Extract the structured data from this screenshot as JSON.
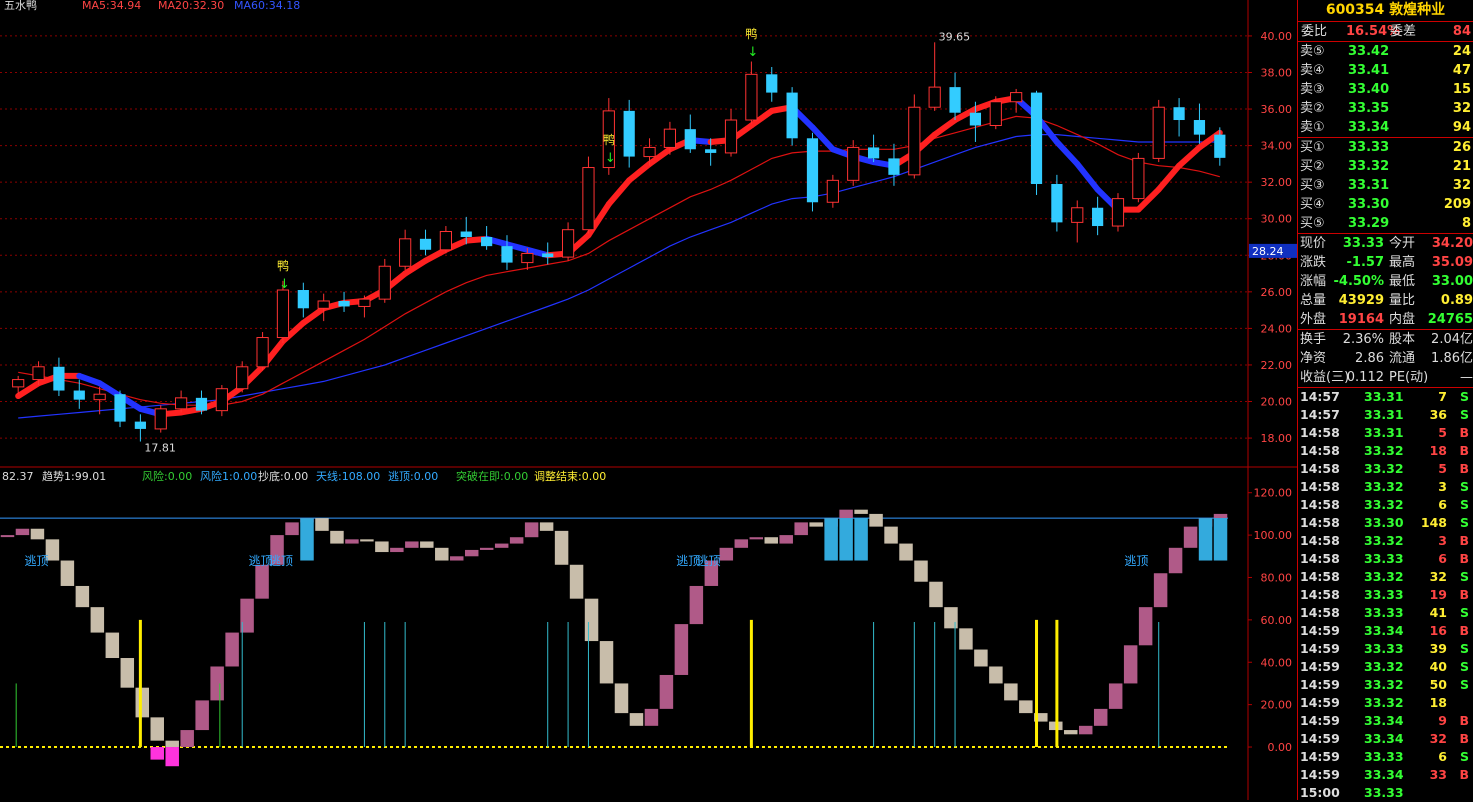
{
  "header": {
    "top_left_name": "五水鸭",
    "ma5_label": "MA5:34.94",
    "ma20_label": "MA20:32.30",
    "ma60_label": "MA60:34.18",
    "indicator_line": [
      {
        "text": "82.37",
        "color": "#dddddd"
      },
      {
        "text": "趋势1:99.01",
        "color": "#dddddd"
      },
      {
        "text": "风险:0.00",
        "color": "#33cc33"
      },
      {
        "text": "风险1:0.00",
        "color": "#33aaff"
      },
      {
        "text": "抄底:0.00",
        "color": "#dddddd"
      },
      {
        "text": "天线:108.00",
        "color": "#33aaff"
      },
      {
        "text": "逃顶:0.00",
        "color": "#33aaff"
      },
      {
        "text": "突破在即:0.00",
        "color": "#33cc33"
      },
      {
        "text": "调整结束:0.00",
        "color": "#ffee33"
      }
    ]
  },
  "colors": {
    "up": "#ff3333",
    "down": "#33ccff",
    "ma_red": "#ff2020",
    "ma_blue": "#2233ff",
    "grid": "#8b0000",
    "axis_text": "#ff4444",
    "pink": "#b05a88",
    "gray": "#c8bdaa",
    "cyan_bar": "#33aadd",
    "yellow": "#ffee00",
    "magenta": "#ff33dd",
    "cyan_low": "#33ffff"
  },
  "chart_data": [
    {
      "type": "candlestick",
      "y_ticks": [
        "18.00",
        "20.00",
        "22.00",
        "24.00",
        "26.00",
        "28.00",
        "30.00",
        "32.00",
        "34.00",
        "36.00",
        "38.00",
        "40.00"
      ],
      "ylim": [
        16.8,
        41.2
      ],
      "current_price_label": "28.24",
      "annotations": [
        {
          "text": "17.81",
          "x_index": 6,
          "value": 17.81
        },
        {
          "text": "39.65",
          "x_index": 45,
          "value": 39.65
        },
        {
          "text": "鸭",
          "x_index": 13,
          "value": 27.2
        },
        {
          "text": "鸭",
          "x_index": 29,
          "value": 34.1
        },
        {
          "text": "鸭",
          "x_index": 36,
          "value": 39.9
        }
      ],
      "candles": [
        [
          20.8,
          21.4,
          20.4,
          21.2
        ],
        [
          21.2,
          22.2,
          20.9,
          21.9
        ],
        [
          21.9,
          22.4,
          20.3,
          20.6
        ],
        [
          20.6,
          21.2,
          19.6,
          20.1
        ],
        [
          20.1,
          20.8,
          19.3,
          20.4
        ],
        [
          20.4,
          20.6,
          18.6,
          18.9
        ],
        [
          18.9,
          19.3,
          17.81,
          18.5
        ],
        [
          18.5,
          19.8,
          18.3,
          19.6
        ],
        [
          19.6,
          20.6,
          19.4,
          20.2
        ],
        [
          20.2,
          20.6,
          19.3,
          19.5
        ],
        [
          19.5,
          20.9,
          19.2,
          20.7
        ],
        [
          20.7,
          22.2,
          20.5,
          21.9
        ],
        [
          21.9,
          23.8,
          21.7,
          23.5
        ],
        [
          23.5,
          26.6,
          23.2,
          26.1
        ],
        [
          26.1,
          26.5,
          24.6,
          25.1
        ],
        [
          25.1,
          25.9,
          24.4,
          25.5
        ],
        [
          25.5,
          26.0,
          24.9,
          25.2
        ],
        [
          25.2,
          25.8,
          24.6,
          25.6
        ],
        [
          25.6,
          27.8,
          25.4,
          27.4
        ],
        [
          27.4,
          29.4,
          27.2,
          28.9
        ],
        [
          28.9,
          29.4,
          28.0,
          28.3
        ],
        [
          28.3,
          29.6,
          28.1,
          29.3
        ],
        [
          29.3,
          30.1,
          28.6,
          29.0
        ],
        [
          29.0,
          29.6,
          28.3,
          28.5
        ],
        [
          28.5,
          29.1,
          27.2,
          27.6
        ],
        [
          27.6,
          28.4,
          27.2,
          28.1
        ],
        [
          28.1,
          28.7,
          27.5,
          27.9
        ],
        [
          27.9,
          29.8,
          27.7,
          29.4
        ],
        [
          29.4,
          33.4,
          29.2,
          32.8
        ],
        [
          32.8,
          36.6,
          32.4,
          35.9
        ],
        [
          35.9,
          36.5,
          32.8,
          33.4
        ],
        [
          33.4,
          34.4,
          32.9,
          33.9
        ],
        [
          33.9,
          35.3,
          33.5,
          34.9
        ],
        [
          34.9,
          35.7,
          33.6,
          33.8
        ],
        [
          33.8,
          34.4,
          32.9,
          33.6
        ],
        [
          33.6,
          36.0,
          33.4,
          35.4
        ],
        [
          35.4,
          38.6,
          35.2,
          37.9
        ],
        [
          37.9,
          38.3,
          36.4,
          36.9
        ],
        [
          36.9,
          37.2,
          34.0,
          34.4
        ],
        [
          34.4,
          34.7,
          30.4,
          30.9
        ],
        [
          30.9,
          32.4,
          30.6,
          32.1
        ],
        [
          32.1,
          34.3,
          31.8,
          33.9
        ],
        [
          33.9,
          34.6,
          33.1,
          33.3
        ],
        [
          33.3,
          34.1,
          31.8,
          32.4
        ],
        [
          32.4,
          36.8,
          32.2,
          36.1
        ],
        [
          36.1,
          39.65,
          35.9,
          37.2
        ],
        [
          37.2,
          38.0,
          35.4,
          35.8
        ],
        [
          35.8,
          36.4,
          34.2,
          35.1
        ],
        [
          35.1,
          36.7,
          34.9,
          36.4
        ],
        [
          36.4,
          37.1,
          35.8,
          36.9
        ],
        [
          36.9,
          37.0,
          31.3,
          31.9
        ],
        [
          31.9,
          32.4,
          29.3,
          29.8
        ],
        [
          29.8,
          31.0,
          28.7,
          30.6
        ],
        [
          30.6,
          31.2,
          29.1,
          29.6
        ],
        [
          29.6,
          31.4,
          29.3,
          31.1
        ],
        [
          31.1,
          33.6,
          30.9,
          33.3
        ],
        [
          33.3,
          36.5,
          33.1,
          36.1
        ],
        [
          36.1,
          36.6,
          34.5,
          35.4
        ],
        [
          35.4,
          36.3,
          34.1,
          34.6
        ],
        [
          34.6,
          35.0,
          32.9,
          33.33
        ]
      ],
      "ma_fast": [
        20.3,
        21.0,
        21.4,
        21.4,
        21.0,
        20.3,
        19.6,
        19.3,
        19.4,
        19.6,
        20.0,
        20.8,
        21.9,
        23.3,
        24.3,
        25.1,
        25.4,
        25.5,
        26.1,
        27.0,
        27.7,
        28.3,
        28.8,
        28.9,
        28.6,
        28.3,
        28.0,
        28.1,
        29.1,
        30.8,
        32.1,
        33.0,
        33.8,
        34.3,
        34.2,
        34.3,
        35.1,
        35.9,
        36.1,
        35.0,
        33.8,
        33.4,
        33.1,
        32.9,
        33.6,
        34.6,
        35.4,
        36.0,
        36.4,
        36.6,
        35.6,
        34.2,
        33.0,
        31.6,
        30.5,
        30.5,
        31.6,
        32.9,
        33.9,
        34.7
      ],
      "ma_mid": [
        21.6,
        21.4,
        21.2,
        21.0,
        20.7,
        20.4,
        20.1,
        19.9,
        19.8,
        19.8,
        19.8,
        20.0,
        20.4,
        21.0,
        21.6,
        22.2,
        22.8,
        23.4,
        24.1,
        24.8,
        25.4,
        26.0,
        26.5,
        26.9,
        27.1,
        27.3,
        27.5,
        27.7,
        28.1,
        28.8,
        29.4,
        30.0,
        30.6,
        31.2,
        31.6,
        32.1,
        32.7,
        33.3,
        33.6,
        33.7,
        33.7,
        33.8,
        33.8,
        33.8,
        34.0,
        34.4,
        34.7,
        35.0,
        35.3,
        35.6,
        35.5,
        35.1,
        34.6,
        34.1,
        33.5,
        33.1,
        32.9,
        32.8,
        32.6,
        32.3
      ],
      "ma_slow": [
        19.1,
        19.2,
        19.3,
        19.4,
        19.5,
        19.6,
        19.7,
        19.8,
        19.9,
        20.0,
        20.1,
        20.3,
        20.5,
        20.7,
        20.9,
        21.1,
        21.4,
        21.7,
        22.0,
        22.4,
        22.8,
        23.2,
        23.6,
        24.0,
        24.4,
        24.8,
        25.2,
        25.6,
        26.1,
        26.7,
        27.3,
        27.9,
        28.5,
        29.0,
        29.4,
        29.8,
        30.3,
        30.8,
        31.1,
        31.2,
        31.4,
        31.7,
        32.0,
        32.3,
        32.7,
        33.1,
        33.5,
        33.9,
        34.2,
        34.5,
        34.6,
        34.6,
        34.5,
        34.4,
        34.3,
        34.2,
        34.2,
        34.2,
        34.2,
        34.2
      ]
    },
    {
      "type": "bar",
      "y_ticks": [
        "0.00",
        "20.00",
        "40.00",
        "60.00",
        "80.00",
        "100.00",
        "120.00"
      ],
      "ylim": [
        -25,
        126
      ],
      "top_line_value": 108,
      "label_text": "逃顶",
      "escape_label_indices": [
        1,
        12,
        13,
        33,
        34,
        55
      ],
      "values": [
        100,
        103,
        98,
        88,
        76,
        66,
        54,
        42,
        28,
        14,
        3,
        0,
        8,
        22,
        38,
        54,
        70,
        86,
        100,
        106,
        108,
        102,
        96,
        98,
        97,
        92,
        94,
        97,
        94,
        88,
        90,
        93,
        94,
        96,
        99,
        106,
        102,
        86,
        70,
        50,
        30,
        16,
        10,
        18,
        34,
        58,
        76,
        88,
        94,
        98,
        99,
        96,
        100,
        106,
        104,
        108,
        112,
        110,
        104,
        96,
        88,
        78,
        66,
        56,
        46,
        38,
        30,
        22,
        16,
        12,
        8,
        6,
        10,
        18,
        30,
        48,
        66,
        82,
        94,
        104,
        108,
        110
      ],
      "signals_yellow": [
        6,
        36,
        50,
        51
      ],
      "signals_cyan": [
        11,
        17,
        18,
        19,
        26,
        27,
        28,
        42,
        44,
        45,
        46,
        56
      ],
      "signals_green": [
        0,
        10
      ]
    }
  ],
  "panel": {
    "title": "600354 敦煌种业",
    "wb": {
      "label1": "委比",
      "value1": "16.54%",
      "label2": "委差",
      "value2": "84"
    },
    "asks": [
      {
        "label": "卖⑤",
        "price": "33.42",
        "vol": "24"
      },
      {
        "label": "卖④",
        "price": "33.41",
        "vol": "47"
      },
      {
        "label": "卖③",
        "price": "33.40",
        "vol": "15"
      },
      {
        "label": "卖②",
        "price": "33.35",
        "vol": "32"
      },
      {
        "label": "卖①",
        "price": "33.34",
        "vol": "94"
      }
    ],
    "bids": [
      {
        "label": "买①",
        "price": "33.33",
        "vol": "26"
      },
      {
        "label": "买②",
        "price": "33.32",
        "vol": "21"
      },
      {
        "label": "买③",
        "price": "33.31",
        "vol": "32"
      },
      {
        "label": "买④",
        "price": "33.30",
        "vol": "209"
      },
      {
        "label": "买⑤",
        "price": "33.29",
        "vol": "8"
      }
    ],
    "quote": [
      {
        "l1": "现价",
        "v1": "33.33",
        "c1": "#33ff33",
        "l2": "今开",
        "v2": "34.20",
        "c2": "#ff4444"
      },
      {
        "l1": "涨跌",
        "v1": "-1.57",
        "c1": "#33ff33",
        "l2": "最高",
        "v2": "35.09",
        "c2": "#ff4444"
      },
      {
        "l1": "涨幅",
        "v1": "-4.50%",
        "c1": "#33ff33",
        "l2": "最低",
        "v2": "33.00",
        "c2": "#33ff33"
      },
      {
        "l1": "总量",
        "v1": "43929",
        "c1": "#ffee33",
        "l2": "量比",
        "v2": "0.89",
        "c2": "#ffee33"
      },
      {
        "l1": "外盘",
        "v1": "19164",
        "c1": "#ff4444",
        "l2": "内盘",
        "v2": "24765",
        "c2": "#33ff33"
      }
    ],
    "info": [
      {
        "l1": "换手",
        "v1": "2.36%",
        "l2": "股本",
        "v2": "2.04亿"
      },
      {
        "l1": "净资",
        "v1": "2.86",
        "l2": "流通",
        "v2": "1.86亿"
      },
      {
        "l1": "收益(三)",
        "v1": "0.112",
        "l2": "PE(动)",
        "v2": "—"
      }
    ],
    "ticks": [
      {
        "time": "14:57",
        "price": "33.31",
        "vol": "7",
        "side": "S"
      },
      {
        "time": "14:57",
        "price": "33.31",
        "vol": "36",
        "side": "S"
      },
      {
        "time": "14:58",
        "price": "33.31",
        "vol": "5",
        "side": "B"
      },
      {
        "time": "14:58",
        "price": "33.32",
        "vol": "18",
        "side": "B"
      },
      {
        "time": "14:58",
        "price": "33.32",
        "vol": "5",
        "side": "B"
      },
      {
        "time": "14:58",
        "price": "33.32",
        "vol": "3",
        "side": "S"
      },
      {
        "time": "14:58",
        "price": "33.32",
        "vol": "6",
        "side": "S"
      },
      {
        "time": "14:58",
        "price": "33.30",
        "vol": "148",
        "side": "S"
      },
      {
        "time": "14:58",
        "price": "33.32",
        "vol": "3",
        "side": "B"
      },
      {
        "time": "14:58",
        "price": "33.33",
        "vol": "6",
        "side": "B"
      },
      {
        "time": "14:58",
        "price": "33.32",
        "vol": "32",
        "side": "S"
      },
      {
        "time": "14:58",
        "price": "33.33",
        "vol": "19",
        "side": "B"
      },
      {
        "time": "14:58",
        "price": "33.33",
        "vol": "41",
        "side": "S"
      },
      {
        "time": "14:59",
        "price": "33.34",
        "vol": "16",
        "side": "B"
      },
      {
        "time": "14:59",
        "price": "33.33",
        "vol": "39",
        "side": "S"
      },
      {
        "time": "14:59",
        "price": "33.32",
        "vol": "40",
        "side": "S"
      },
      {
        "time": "14:59",
        "price": "33.32",
        "vol": "50",
        "side": "S"
      },
      {
        "time": "14:59",
        "price": "33.32",
        "vol": "18",
        "side": ""
      },
      {
        "time": "14:59",
        "price": "33.34",
        "vol": "9",
        "side": "B"
      },
      {
        "time": "14:59",
        "price": "33.34",
        "vol": "32",
        "side": "B"
      },
      {
        "time": "14:59",
        "price": "33.33",
        "vol": "6",
        "side": "S"
      },
      {
        "time": "14:59",
        "price": "33.34",
        "vol": "33",
        "side": "B"
      },
      {
        "time": "15:00",
        "price": "33.33",
        "vol": "",
        "side": ""
      }
    ]
  }
}
